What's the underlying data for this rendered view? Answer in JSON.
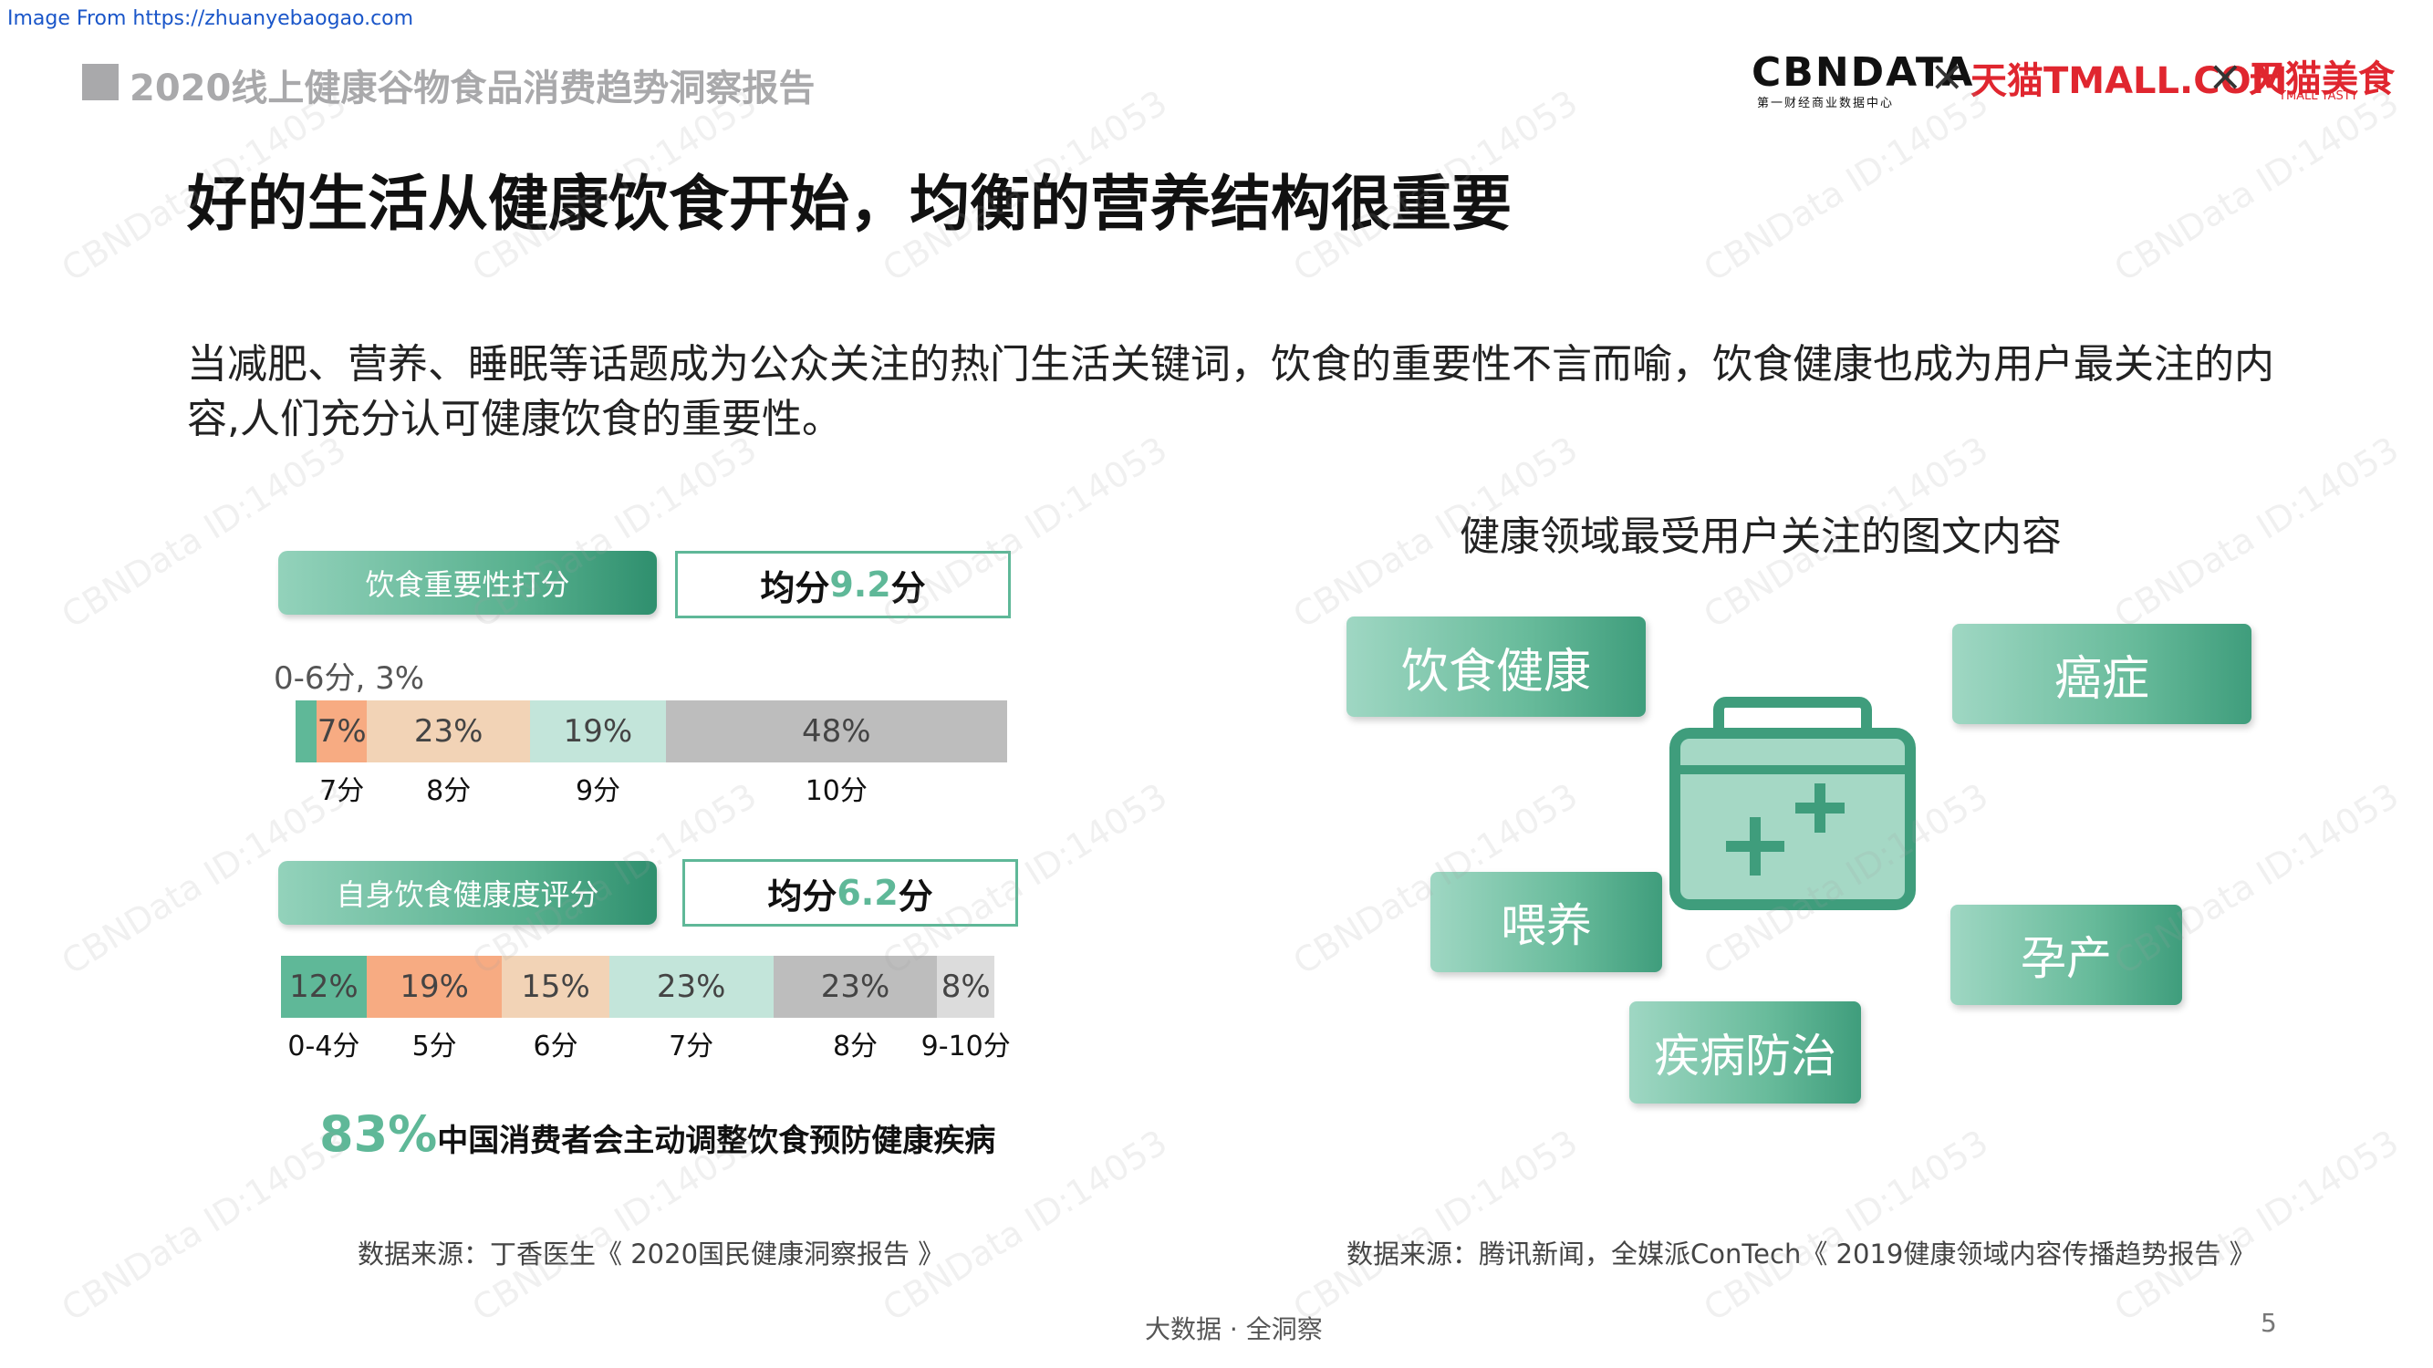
{
  "credit": "Image From https://zhuanyebaogao.com",
  "header": {
    "report_title": "2020线上健康谷物食品消费趋势洞察报告",
    "logos": {
      "cbndata": "CBNDATA",
      "cbndata_sub": "第一财经商业数据中心",
      "tmall": "天猫TMALL.COM",
      "tmall_tasty": "天猫美食",
      "tmall_tasty_sub": "TMALL TASTY",
      "separator": "×"
    }
  },
  "title": "好的生活从健康饮食开始，均衡的营养结构很重要",
  "lead_text": "当减肥、营养、睡眠等话题成为公众关注的热门生活关键词，饮食的重要性不言而喻，饮食健康也成为用户最关注的内容,人们充分认可健康饮食的重要性。",
  "left_panel": {
    "importance": {
      "label": "饮食重要性打分",
      "avg_prefix": "均分",
      "avg_value": "9.2",
      "avg_suffix": "分",
      "note": "0-6分, 3%"
    },
    "self_rating": {
      "label": "自身饮食健康度评分",
      "avg_prefix": "均分",
      "avg_value": "6.2",
      "avg_suffix": "分"
    },
    "stat_pct": "83%",
    "stat_text": "中国消费者会主动调整饮食预防健康疾病",
    "source": "数据来源：丁香医生《 2020国民健康洞察报告 》"
  },
  "chart_data": [
    {
      "type": "bar",
      "stacked": true,
      "orientation": "horizontal",
      "title": "饮食重要性打分",
      "categories": [
        "0-6分",
        "7分",
        "8分",
        "9分",
        "10分"
      ],
      "values": [
        3,
        7,
        23,
        19,
        48
      ],
      "value_labels": [
        "",
        "7%",
        "23%",
        "19%",
        "48%"
      ],
      "tick_labels": [
        "7分",
        "8分",
        "9分",
        "10分"
      ],
      "colors": [
        "#5fb898",
        "#f7ab82",
        "#f2d3b6",
        "#c3e5da",
        "#bdbdbd"
      ],
      "unit": "%"
    },
    {
      "type": "bar",
      "stacked": true,
      "orientation": "horizontal",
      "title": "自身饮食健康度评分",
      "categories": [
        "0-4分",
        "5分",
        "6分",
        "7分",
        "8分",
        "9-10分"
      ],
      "values": [
        12,
        19,
        15,
        23,
        23,
        8
      ],
      "value_labels": [
        "12%",
        "19%",
        "15%",
        "23%",
        "23%",
        "8%"
      ],
      "tick_labels": [
        "0-4分",
        "5分",
        "6分",
        "7分",
        "8分",
        "9-10分"
      ],
      "colors": [
        "#5fb898",
        "#f7ab82",
        "#f2d3b6",
        "#c3e5da",
        "#bdbdbd",
        "#dcdcdc"
      ],
      "unit": "%"
    }
  ],
  "right_panel": {
    "title": "健康领域最受用户关注的图文内容",
    "topics": [
      "饮食健康",
      "癌症",
      "喂养",
      "孕产",
      "疾病防治"
    ],
    "icon": "medical-kit-icon",
    "source": "数据来源：腾讯新闻，全媒派ConTech《 2019健康领域内容传播趋势报告 》"
  },
  "footer": {
    "center": "大数据 · 全洞察",
    "page": "5"
  },
  "watermark": "CBNData ID:14053"
}
